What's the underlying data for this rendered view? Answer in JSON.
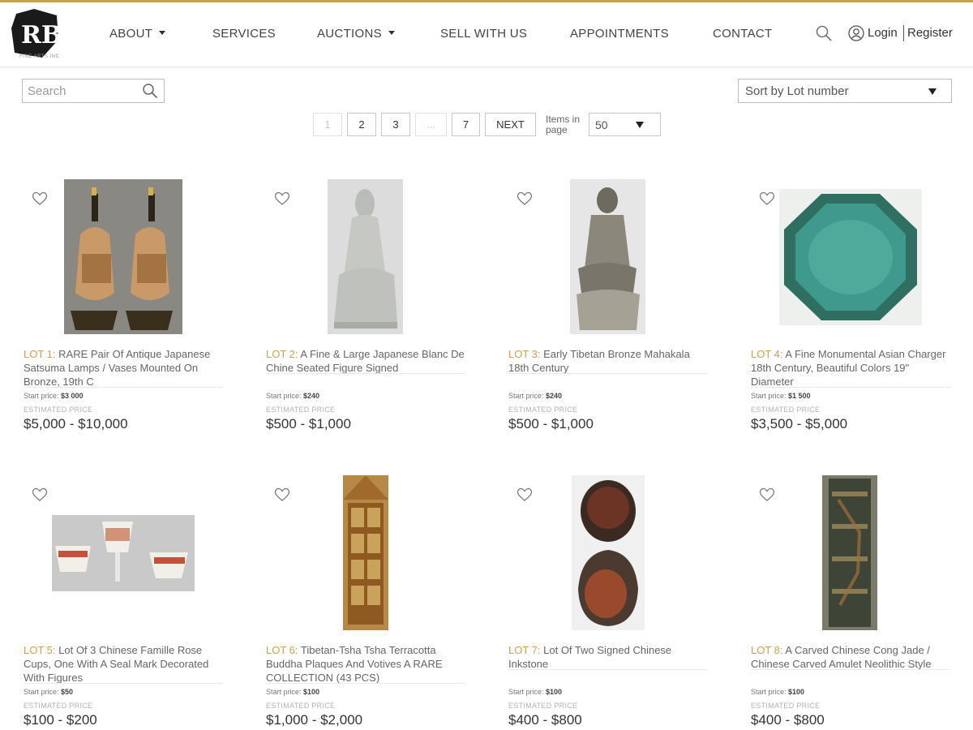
{
  "header": {
    "logo_text": "RB",
    "logo_subtext": "FINE ARTS INC",
    "nav": [
      {
        "label": "ABOUT",
        "dropdown": true
      },
      {
        "label": "SERVICES",
        "dropdown": false
      },
      {
        "label": "AUCTIONS",
        "dropdown": true
      },
      {
        "label": "SELL WITH US",
        "dropdown": false
      },
      {
        "label": "APPOINTMENTS",
        "dropdown": false
      },
      {
        "label": "CONTACT",
        "dropdown": false
      }
    ],
    "login": "Login",
    "register": "Register",
    "accent_color": "#c9a24b"
  },
  "toolbar": {
    "search_placeholder": "Search",
    "sort_value": "Sort by Lot number"
  },
  "pagination": {
    "pages": [
      "1",
      "2",
      "3",
      "...",
      "7"
    ],
    "current": "1",
    "next": "NEXT",
    "items_label": "Items in page",
    "items_value": "50"
  },
  "lots": [
    {
      "lot": "LOT 1:",
      "title": "RARE Pair Of Antique Japanese Satsuma Lamps / Vases Mounted On Bronze, 19th C",
      "start_label": "Start price:",
      "start": "$3 000",
      "est_label": "ESTIMATED PRICE",
      "est": "$5,000 - $10,000",
      "image": "satsuma-lamps-image"
    },
    {
      "lot": "LOT 2:",
      "title": "A Fine & Large Japanese Blanc De Chine Seated Figure Signed",
      "start_label": "Start price:",
      "start": "$240",
      "est_label": "ESTIMATED PRICE",
      "est": "$500 - $1,000",
      "image": "blanc-de-chine-figure-image"
    },
    {
      "lot": "LOT 3:",
      "title": "Early Tibetan Bronze Mahakala 18th Century",
      "start_label": "Start price:",
      "start": "$240",
      "est_label": "ESTIMATED PRICE",
      "est": "$500 - $1,000",
      "image": "bronze-mahakala-image"
    },
    {
      "lot": "LOT 4:",
      "title": "A Fine Monumental Asian Charger 18th Century, Beautiful Colors 19\" Diameter",
      "start_label": "Start price:",
      "start": "$1 500",
      "est_label": "ESTIMATED PRICE",
      "est": "$3,500 - $5,000",
      "image": "asian-charger-image"
    },
    {
      "lot": "LOT 5:",
      "title": "Lot Of 3 Chinese Famille Rose Cups, One With A Seal Mark Decorated With Figures",
      "start_label": "Start price:",
      "start": "$50",
      "est_label": "ESTIMATED PRICE",
      "est": "$100 - $200",
      "image": "famille-rose-cups-image"
    },
    {
      "lot": "LOT 6:",
      "title": "Tibetan-Tsha Tsha Terracotta Buddha Plaques And Votives A RARE COLLECTION (43 PCS)",
      "start_label": "Start price:",
      "start": "$100",
      "est_label": "ESTIMATED PRICE",
      "est": "$1,000 - $2,000",
      "image": "tsha-tsha-plaques-image"
    },
    {
      "lot": "LOT 7:",
      "title": "Lot Of Two Signed Chinese Inkstone",
      "start_label": "Start price:",
      "start": "$100",
      "est_label": "ESTIMATED PRICE",
      "est": "$400 - $800",
      "image": "inkstone-image"
    },
    {
      "lot": "LOT 8:",
      "title": "A Carved Chinese Cong Jade / Chinese Carved Amulet Neolithic Style",
      "start_label": "Start price:",
      "start": "$100",
      "est_label": "ESTIMATED PRICE",
      "est": "$400 - $800",
      "image": "cong-jade-image"
    }
  ]
}
